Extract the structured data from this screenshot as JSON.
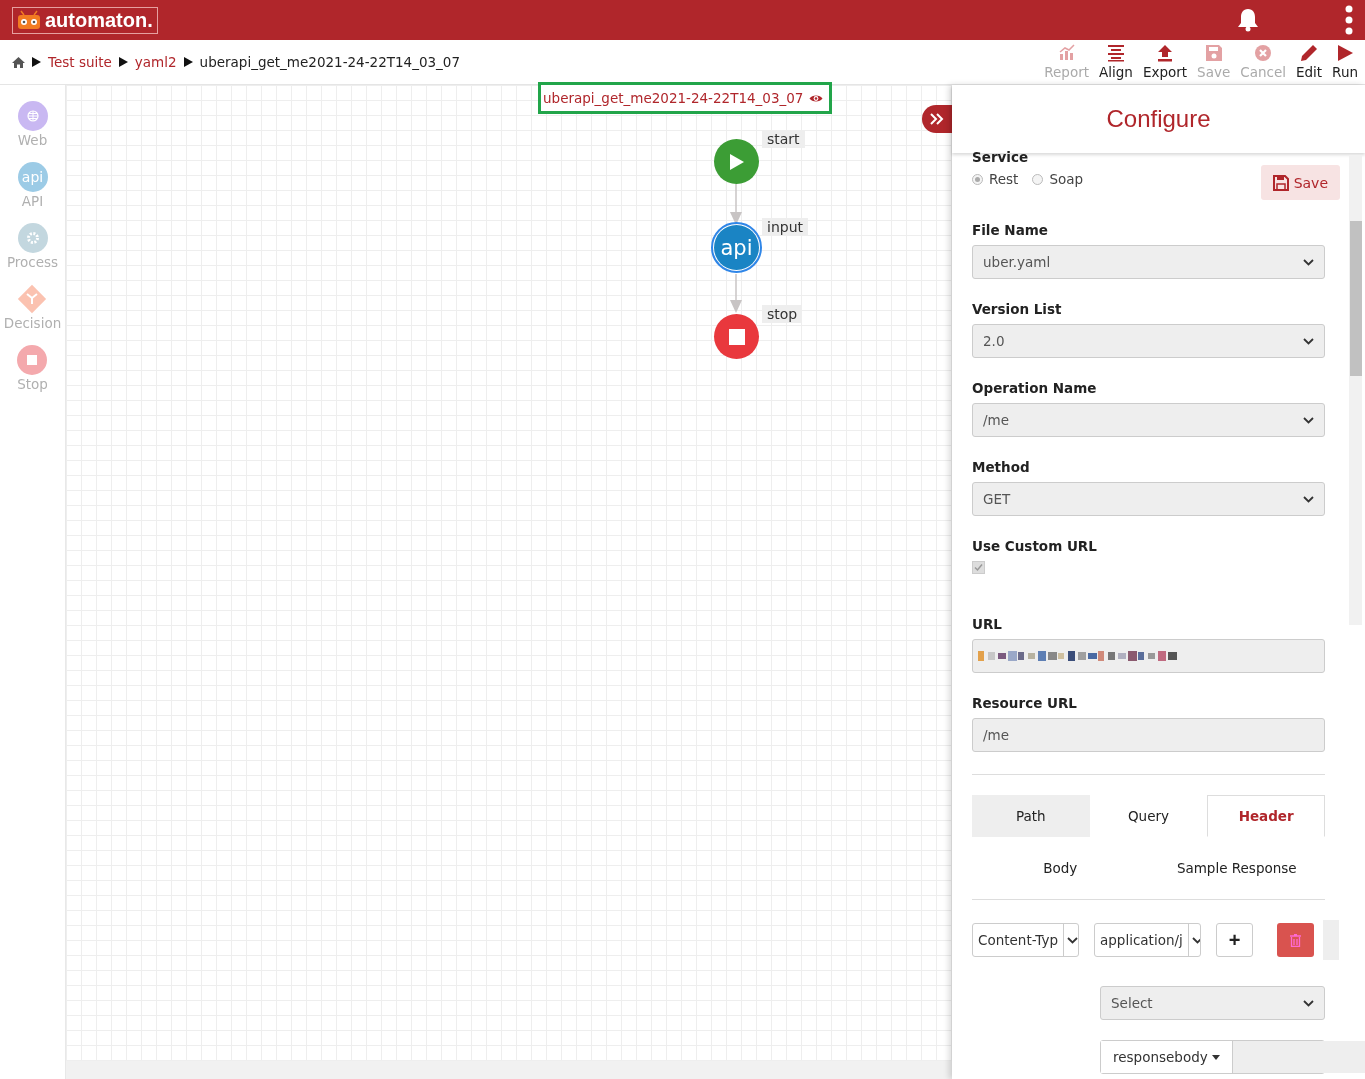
{
  "header": {
    "logo": "automaton."
  },
  "breadcrumbs": [
    {
      "label": "Test suite",
      "kind": "link"
    },
    {
      "label": "yaml2",
      "kind": "link"
    },
    {
      "label": "uberapi_get_me2021-24-22T14_03_07",
      "kind": "current"
    }
  ],
  "toolbar": [
    {
      "label": "Report",
      "kind": "chart",
      "disabled": true
    },
    {
      "label": "Align",
      "kind": "align",
      "disabled": false
    },
    {
      "label": "Export",
      "kind": "upload",
      "disabled": false
    },
    {
      "label": "Save",
      "kind": "save",
      "disabled": true
    },
    {
      "label": "Cancel",
      "kind": "cancel",
      "disabled": true
    },
    {
      "label": "Edit",
      "kind": "pencil",
      "disabled": false
    },
    {
      "label": "Run",
      "kind": "play",
      "disabled": false
    }
  ],
  "palette": [
    {
      "label": "Web",
      "kind": "web"
    },
    {
      "label": "API",
      "kind": "api",
      "icon_text": "api"
    },
    {
      "label": "Process",
      "kind": "process"
    },
    {
      "label": "Decision",
      "kind": "decision"
    },
    {
      "label": "Stop",
      "kind": "stop"
    }
  ],
  "canvas": {
    "title": "uberapi_get_me2021-24-22T14_03_07",
    "nodes": [
      {
        "kind": "start",
        "label": "start",
        "selected": false
      },
      {
        "kind": "api",
        "label": "input",
        "icon_text": "api",
        "selected": true
      },
      {
        "kind": "stop",
        "label": "stop",
        "selected": false
      }
    ]
  },
  "panel": {
    "title": "Configure",
    "service_label": "Service",
    "radios": [
      {
        "label": "Rest",
        "selected": true
      },
      {
        "label": "Soap",
        "selected": false
      }
    ],
    "save_button": "Save",
    "fields": [
      {
        "kind": "select",
        "label": "File Name",
        "value": "uber.yaml"
      },
      {
        "kind": "select",
        "label": "Version List",
        "value": "2.0"
      },
      {
        "kind": "select",
        "label": "Operation Name",
        "value": "/me"
      },
      {
        "kind": "select",
        "label": "Method",
        "value": "GET"
      },
      {
        "kind": "checkbox",
        "label": "Use Custom URL",
        "checked": true
      },
      {
        "kind": "redacted",
        "label": "URL"
      },
      {
        "kind": "input",
        "label": "Resource URL",
        "value": "/me"
      }
    ],
    "tabs": [
      {
        "label": "Path",
        "selected": false
      },
      {
        "label": "Query",
        "selected": false
      },
      {
        "label": "Header",
        "selected": true
      },
      {
        "label": "Body",
        "selected": false
      },
      {
        "label": "Sample Response",
        "selected": false
      }
    ],
    "header_row": {
      "key": "Content-Typ",
      "value": "application/j",
      "add": "+"
    },
    "select": "Select",
    "response": {
      "dropdown": "responsebody"
    }
  }
}
